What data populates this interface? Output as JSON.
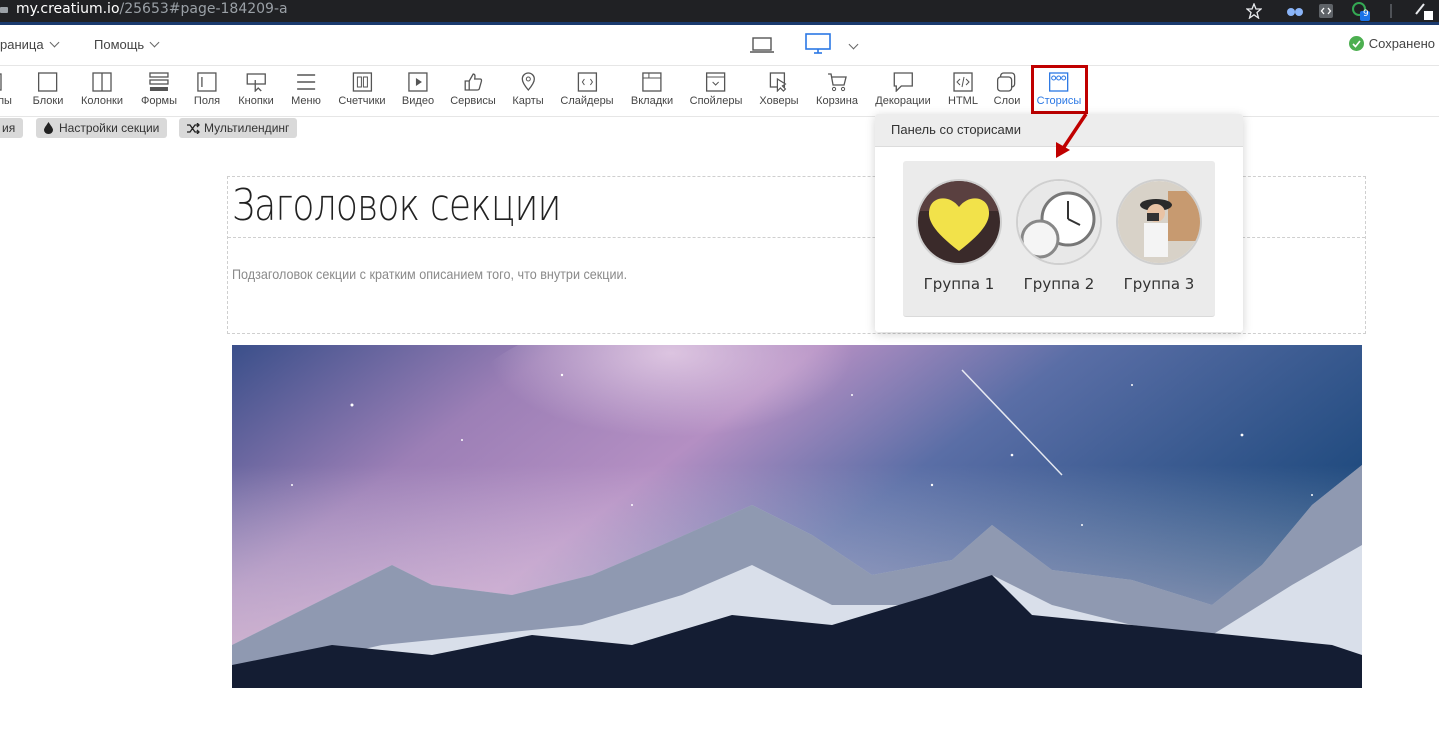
{
  "browser": {
    "url_domain": "my.creatium.io",
    "url_path": "/25653#page-184209-a",
    "ext_badge": "9"
  },
  "topbar": {
    "page_menu_label": "раница",
    "help_menu_label": "Помощь",
    "saved_label": "Сохранено"
  },
  "toolbar": {
    "items": [
      {
        "label": "пы",
        "icon": "grid-icon"
      },
      {
        "label": "Блоки",
        "icon": "square-icon"
      },
      {
        "label": "Колонки",
        "icon": "columns-icon"
      },
      {
        "label": "Формы",
        "icon": "form-icon"
      },
      {
        "label": "Поля",
        "icon": "field-icon"
      },
      {
        "label": "Кнопки",
        "icon": "cursor-button-icon"
      },
      {
        "label": "Меню",
        "icon": "menu-icon"
      },
      {
        "label": "Счетчики",
        "icon": "counter-icon"
      },
      {
        "label": "Видео",
        "icon": "play-icon"
      },
      {
        "label": "Сервисы",
        "icon": "thumbs-up-icon"
      },
      {
        "label": "Карты",
        "icon": "map-pin-icon"
      },
      {
        "label": "Слайдеры",
        "icon": "slider-icon"
      },
      {
        "label": "Вкладки",
        "icon": "tabs-icon"
      },
      {
        "label": "Спойлеры",
        "icon": "spoiler-icon"
      },
      {
        "label": "Ховеры",
        "icon": "hover-cursor-icon"
      },
      {
        "label": "Корзина",
        "icon": "cart-icon"
      },
      {
        "label": "Декорации",
        "icon": "speech-bubble-icon"
      },
      {
        "label": "HTML",
        "icon": "code-icon"
      },
      {
        "label": "Слои",
        "icon": "layers-icon"
      },
      {
        "label": "Сторисы",
        "icon": "stories-icon",
        "active": true
      }
    ]
  },
  "section_tags": {
    "tag_left": "ия",
    "tag_settings": "Настройки секции",
    "tag_multilanding": "Мультилендинг"
  },
  "section": {
    "title": "Заголовок секции",
    "subtitle": "Подзаголовок секции с кратким описанием того, что внутри секции."
  },
  "stories_panel": {
    "title": "Панель со сторисами",
    "groups": [
      {
        "label": "Группа 1",
        "image": "yellow-heart-leaf"
      },
      {
        "label": "Группа 2",
        "image": "pocket-watches"
      },
      {
        "label": "Группа 3",
        "image": "girl-with-camera"
      }
    ]
  },
  "colors": {
    "accent_blue": "#2b78e4",
    "highlight_red": "#c00000",
    "saved_green": "#4caf50"
  }
}
